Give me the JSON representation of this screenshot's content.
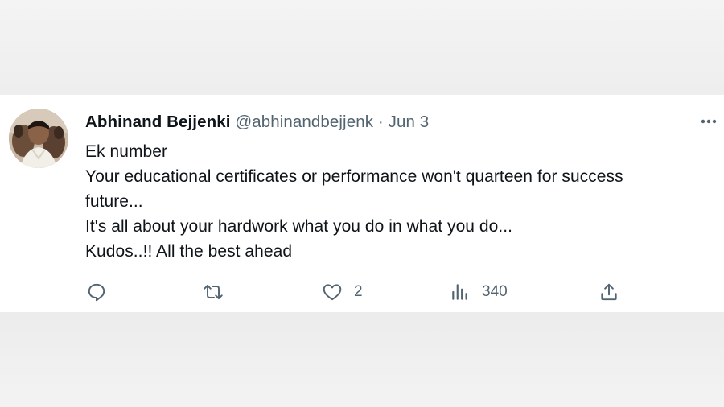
{
  "tweet": {
    "display_name": "Abhinand Bejjenki",
    "handle": "@abhinandbejjenk",
    "separator": "·",
    "date": "Jun 3",
    "lines": [
      "Ek number",
      "Your educational certificates or performance won't quarteen for success",
      "future...",
      "It's all about your hardwork what you do in what you do...",
      "Kudos..!! All the best ahead"
    ],
    "likes": "2",
    "views": "340"
  },
  "icons": {
    "reply": "reply-icon",
    "retweet": "retweet-icon",
    "like": "heart-icon",
    "views": "views-icon",
    "share": "share-icon",
    "more": "more-icon"
  },
  "colors": {
    "text_primary": "#0f1419",
    "text_secondary": "#536471",
    "background": "#ffffff",
    "backdrop": "#f1f1f1"
  }
}
